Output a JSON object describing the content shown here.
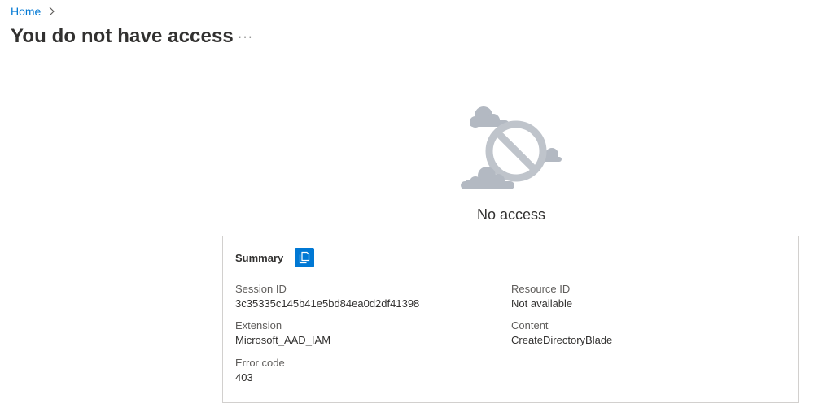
{
  "breadcrumb": {
    "home_label": "Home"
  },
  "page": {
    "title": "You do not have access",
    "more_label": "···"
  },
  "status": {
    "text": "No access"
  },
  "summary": {
    "title": "Summary",
    "fields": {
      "session_id": {
        "label": "Session ID",
        "value": "3c35335c145b41e5bd84ea0d2df41398"
      },
      "resource_id": {
        "label": "Resource ID",
        "value": "Not available"
      },
      "extension": {
        "label": "Extension",
        "value": "Microsoft_AAD_IAM"
      },
      "content": {
        "label": "Content",
        "value": "CreateDirectoryBlade"
      },
      "error_code": {
        "label": "Error code",
        "value": "403"
      }
    }
  },
  "icons": {
    "chevron": "chevron-right-icon",
    "copy": "copy-icon",
    "illustration": "no-access-illustration"
  },
  "colors": {
    "accent": "#0078d4",
    "text": "#323130",
    "label": "#605e5c",
    "border": "#d2d0ce",
    "illustration": "#b3b9c2"
  }
}
